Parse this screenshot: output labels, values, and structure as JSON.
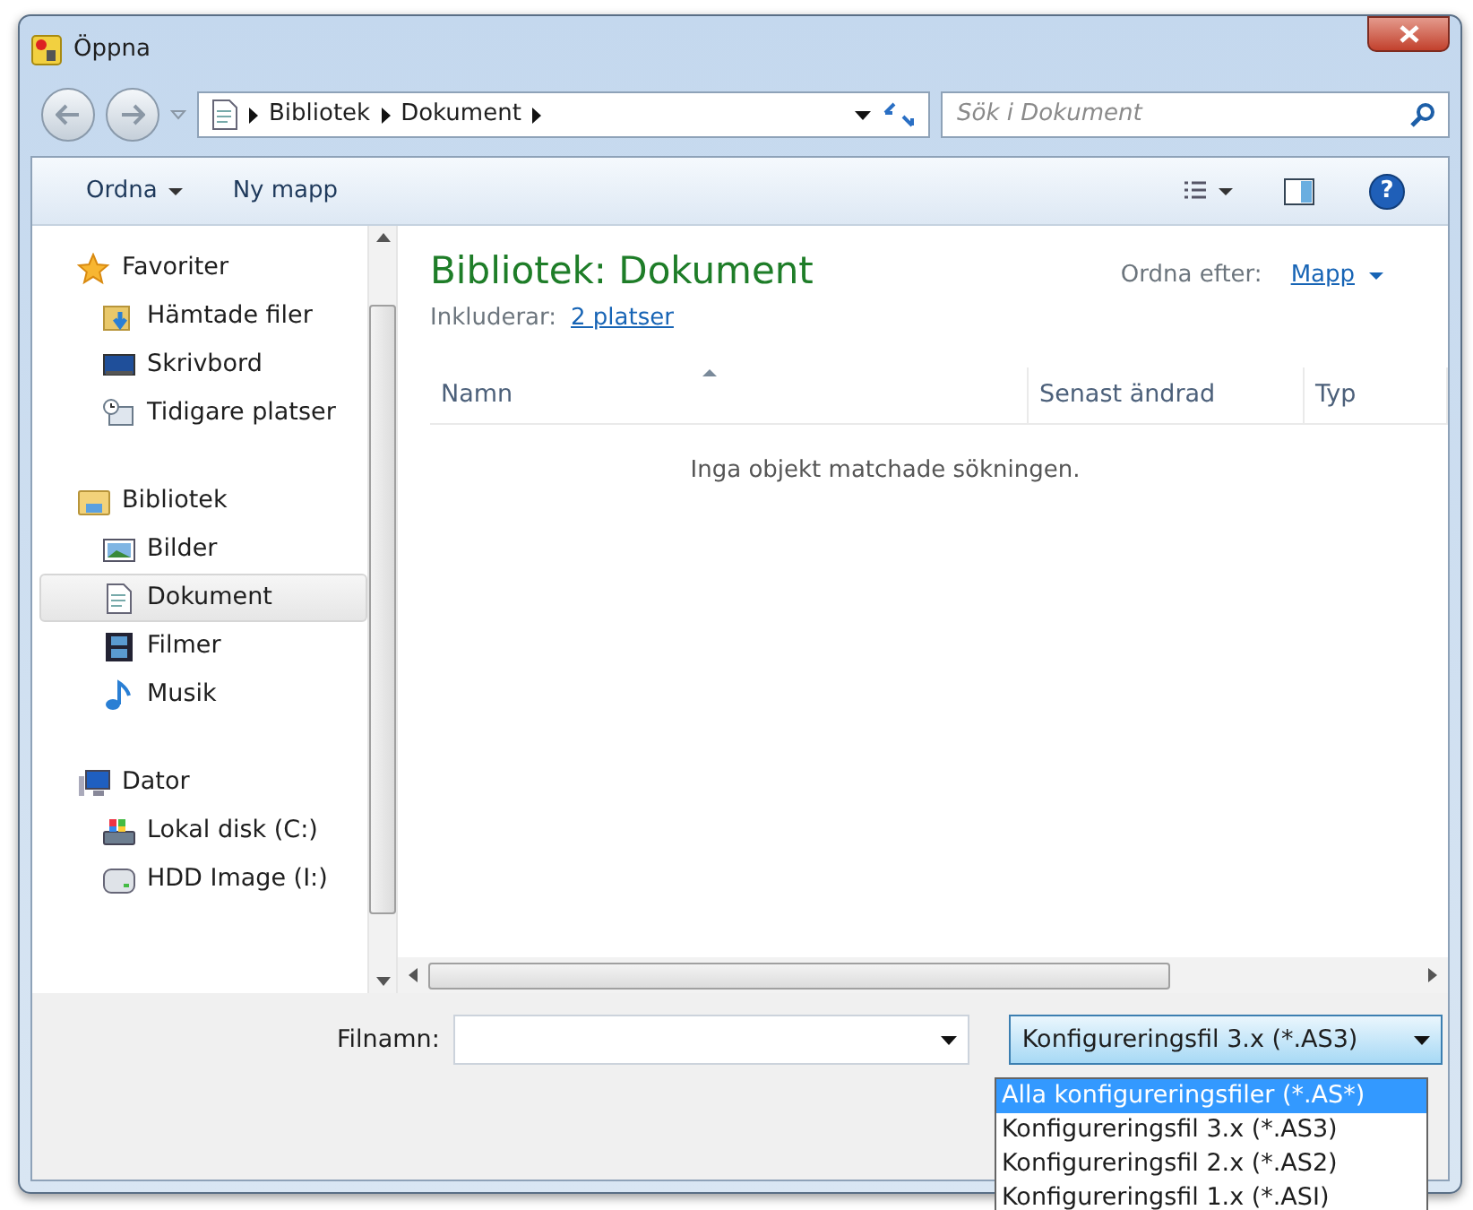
{
  "window": {
    "title": "Öppna"
  },
  "address_bar": {
    "path": [
      "Bibliotek",
      "Dokument"
    ],
    "search_placeholder": "Sök i Dokument"
  },
  "help_button": {
    "glyph": "?"
  },
  "toolbar": [
    {
      "label": "Ordna",
      "kind": "menu"
    },
    {
      "label": "Ny mapp",
      "kind": "button"
    }
  ],
  "sidebar": {
    "groups": [
      {
        "label": "Favoriter",
        "kind": "star",
        "items": [
          {
            "label": "Hämtade filer",
            "kind": "download",
            "selected": false
          },
          {
            "label": "Skrivbord",
            "kind": "desktop",
            "selected": false
          },
          {
            "label": "Tidigare platser",
            "kind": "recent",
            "selected": false
          }
        ]
      },
      {
        "label": "Bibliotek",
        "kind": "library",
        "items": [
          {
            "label": "Bilder",
            "kind": "pictures",
            "selected": false
          },
          {
            "label": "Dokument",
            "kind": "document",
            "selected": true
          },
          {
            "label": "Filmer",
            "kind": "film",
            "selected": false
          },
          {
            "label": "Musik",
            "kind": "music",
            "selected": false
          }
        ]
      },
      {
        "label": "Dator",
        "kind": "computer",
        "items": [
          {
            "label": "Lokal disk (C:)",
            "kind": "disk",
            "selected": false
          },
          {
            "label": "HDD Image (I:)",
            "kind": "drive",
            "selected": false
          }
        ]
      }
    ]
  },
  "content": {
    "title": "Bibliotek: Dokument",
    "includes_label": "Inkluderar:",
    "includes_link": "2 platser",
    "arrange_label": "Ordna efter:",
    "arrange_value": "Mapp",
    "columns": [
      {
        "label": "Namn",
        "sorted": true
      },
      {
        "label": "Senast ändrad",
        "sorted": false
      },
      {
        "label": "Typ",
        "sorted": false
      }
    ],
    "empty_message": "Inga objekt matchade sökningen."
  },
  "footer": {
    "filename_label": "Filnamn:",
    "filetype": "Konfigureringsfil 3.x (*.AS3)",
    "filetype_options": [
      {
        "label": "Alla konfigureringsfiler (*.AS*)",
        "selected": true
      },
      {
        "label": "Konfigureringsfil 3.x (*.AS3)",
        "selected": false
      },
      {
        "label": "Konfigureringsfil 2.x (*.AS2)",
        "selected": false
      },
      {
        "label": "Konfigureringsfil 1.x (*.ASI)",
        "selected": false
      }
    ]
  }
}
